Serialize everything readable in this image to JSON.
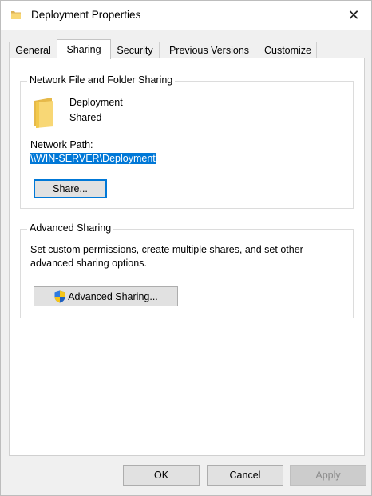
{
  "window": {
    "title": "Deployment Properties",
    "close_glyph": "✕"
  },
  "tabs": [
    {
      "label": "General",
      "active": false
    },
    {
      "label": "Sharing",
      "active": true
    },
    {
      "label": "Security",
      "active": false
    },
    {
      "label": "Previous Versions",
      "active": false
    },
    {
      "label": "Customize",
      "active": false
    }
  ],
  "network_sharing": {
    "legend": "Network File and Folder Sharing",
    "folder_name": "Deployment",
    "folder_status": "Shared",
    "network_path_label": "Network Path:",
    "network_path": "\\\\WIN-SERVER\\Deployment",
    "share_button": "Share..."
  },
  "advanced_sharing": {
    "legend": "Advanced Sharing",
    "description_line1": "Set custom permissions, create multiple shares, and set other",
    "description_line2": "advanced sharing options.",
    "button": "Advanced Sharing..."
  },
  "footer": {
    "ok": "OK",
    "cancel": "Cancel",
    "apply": "Apply"
  },
  "icons": {
    "title": "folder-icon",
    "close": "close-icon",
    "folder": "folder-icon",
    "shield": "uac-shield-icon"
  },
  "colors": {
    "selection": "#0078d7",
    "folder": "#f8d775",
    "disabled_button": "#cccccc"
  }
}
